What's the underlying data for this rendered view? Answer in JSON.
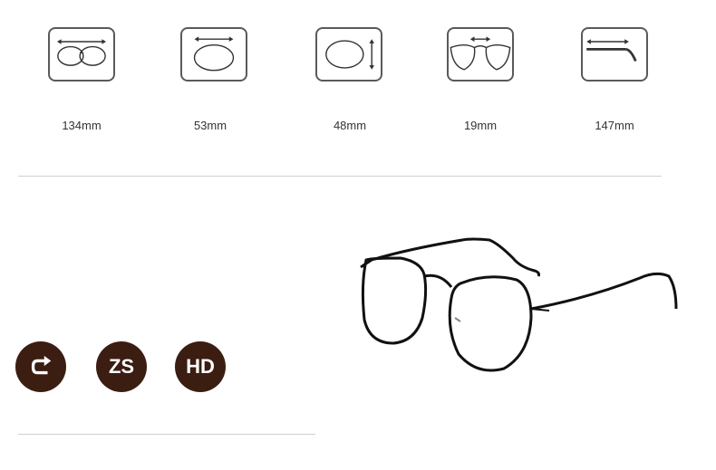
{
  "measurements": [
    {
      "icon": "total-width-icon",
      "value": "134mm"
    },
    {
      "icon": "lens-width-icon",
      "value": "53mm"
    },
    {
      "icon": "lens-height-icon",
      "value": "48mm"
    },
    {
      "icon": "bridge-width-icon",
      "value": "19mm"
    },
    {
      "icon": "temple-length-icon",
      "value": "147mm"
    }
  ],
  "badges": [
    {
      "icon": "return-arrow-icon",
      "label": ""
    },
    {
      "icon": "zs-badge",
      "label": "ZS"
    },
    {
      "icon": "hd-badge",
      "label": "HD"
    }
  ],
  "colors": {
    "badge_bg": "#3b1d12",
    "icon_stroke": "#5a5a5a",
    "frame": "#111111"
  }
}
